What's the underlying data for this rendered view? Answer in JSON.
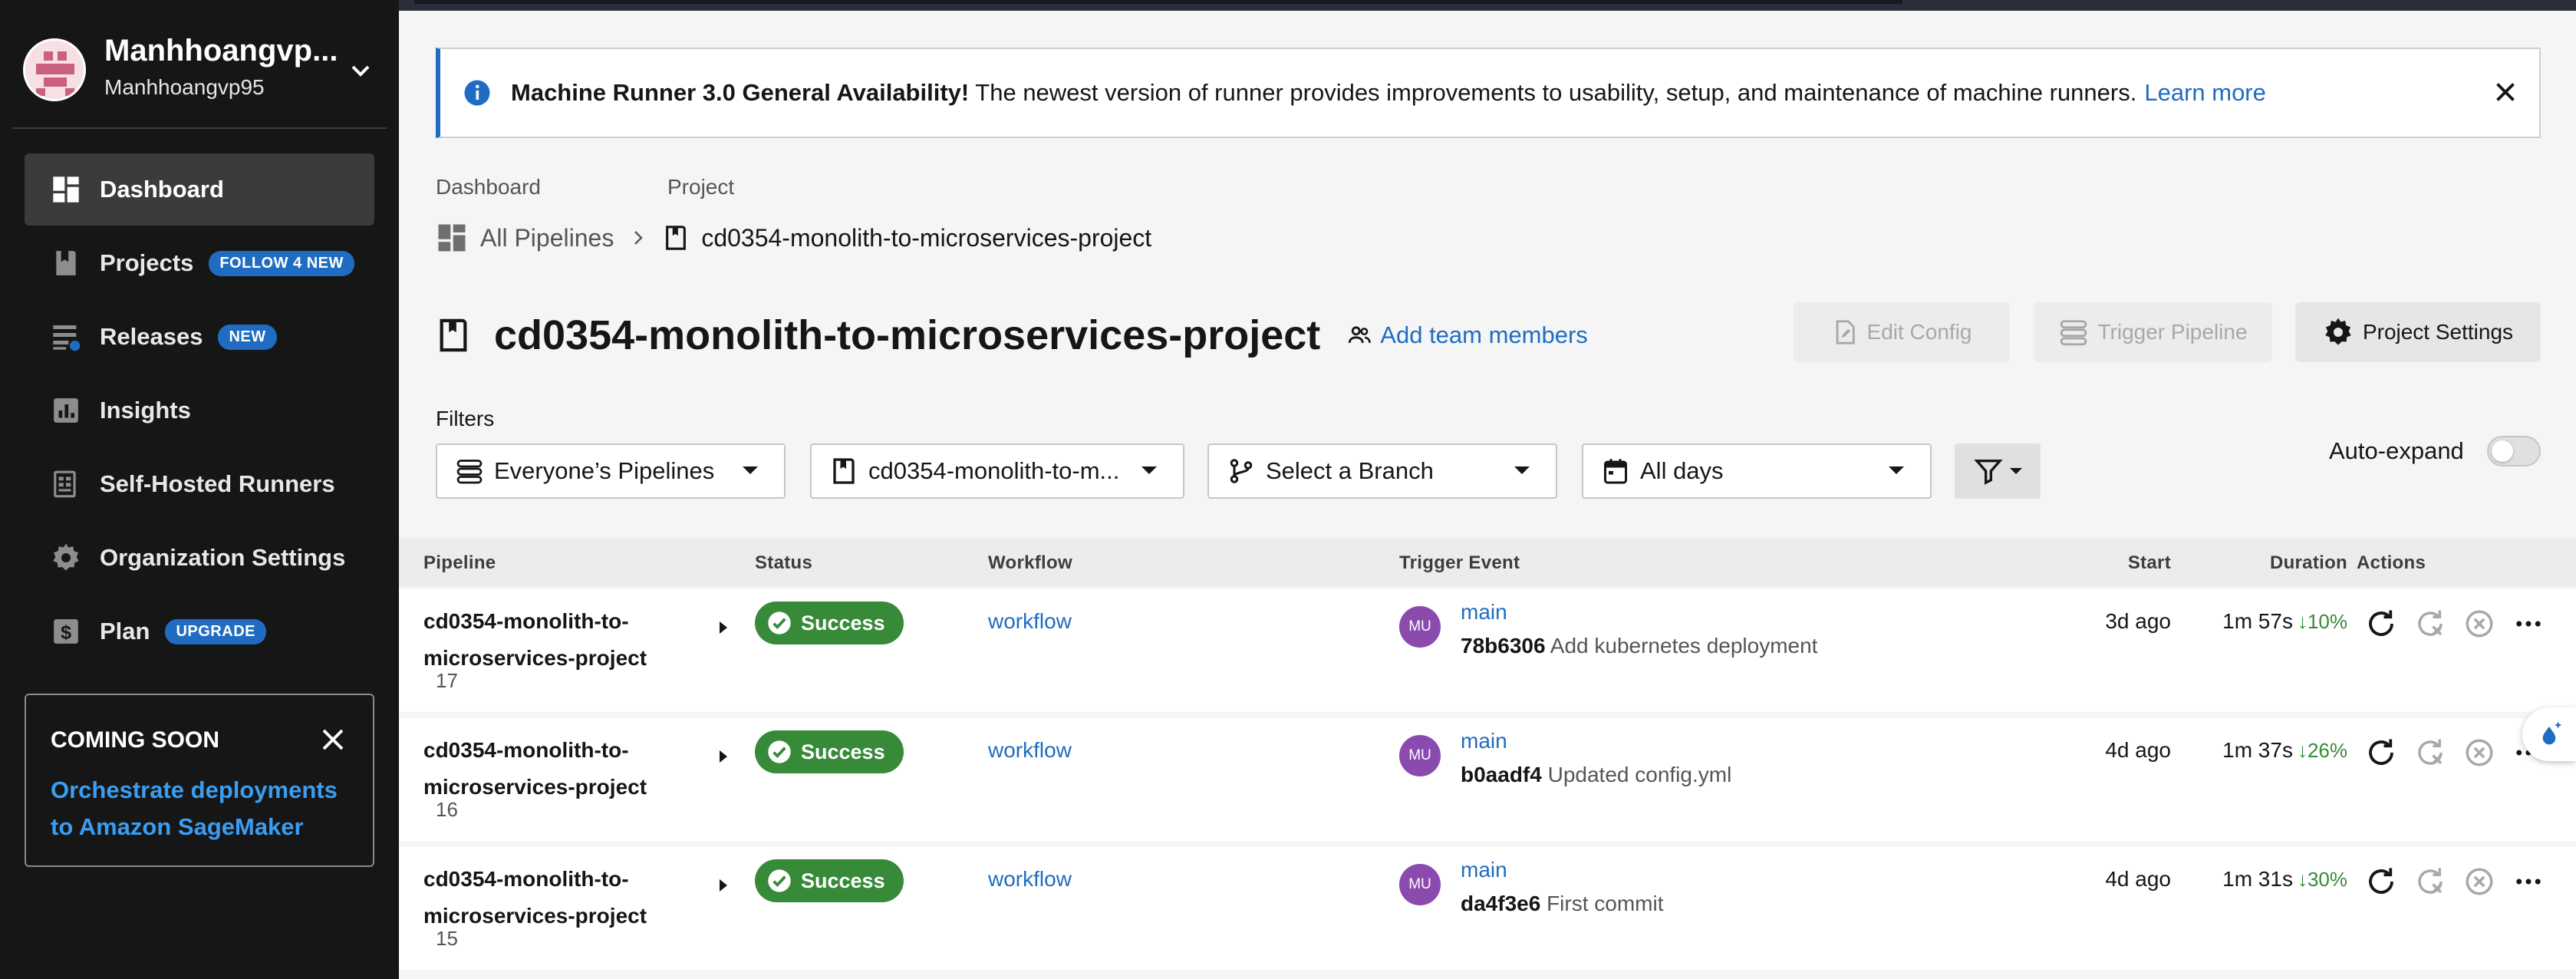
{
  "sidebar": {
    "org_name": "Manhhoangvp...",
    "org_user": "Manhhoangvp95",
    "items": [
      {
        "label": "Dashboard",
        "badge": ""
      },
      {
        "label": "Projects",
        "badge": "FOLLOW 4 NEW"
      },
      {
        "label": "Releases",
        "badge": "NEW"
      },
      {
        "label": "Insights",
        "badge": ""
      },
      {
        "label": "Self-Hosted Runners",
        "badge": ""
      },
      {
        "label": "Organization Settings",
        "badge": ""
      },
      {
        "label": "Plan",
        "badge": "UPGRADE"
      }
    ],
    "coming_soon": {
      "title": "COMING SOON",
      "link": "Orchestrate deployments to Amazon SageMaker"
    }
  },
  "banner": {
    "bold": "Machine Runner 3.0 General Availability!",
    "text": " The newest version of runner provides improvements to usability, setup, and maintenance of machine runners.",
    "link": "Learn more"
  },
  "breadcrumb": {
    "head_dashboard": "Dashboard",
    "head_project": "Project",
    "all_pipelines": "All Pipelines",
    "project": "cd0354-monolith-to-microservices-project"
  },
  "header": {
    "title": "cd0354-monolith-to-microservices-project",
    "add_team": "Add team members",
    "edit_config": "Edit Config",
    "trigger_pipeline": "Trigger Pipeline",
    "project_settings": "Project Settings"
  },
  "filters": {
    "label": "Filters",
    "pipelines": "Everyone’s Pipelines",
    "project": "cd0354-monolith-to-m...",
    "branch": "Select a Branch",
    "days": "All days",
    "auto_expand": "Auto-expand"
  },
  "table": {
    "headers": {
      "pipeline": "Pipeline",
      "status": "Status",
      "workflow": "Workflow",
      "trigger": "Trigger Event",
      "start": "Start",
      "duration": "Duration",
      "actions": "Actions"
    },
    "rows": [
      {
        "pipeline": "cd0354-monolith-to-microservices-project",
        "number": "17",
        "status": "Success",
        "workflow": "workflow",
        "avatar": "MU",
        "branch": "main",
        "sha": "78b6306",
        "message": " Add kubernetes deployment",
        "start": "3d ago",
        "duration": "1m 57s",
        "pct": "10%"
      },
      {
        "pipeline": "cd0354-monolith-to-microservices-project",
        "number": "16",
        "status": "Success",
        "workflow": "workflow",
        "avatar": "MU",
        "branch": "main",
        "sha": "b0aadf4",
        "message": " Updated config.yml",
        "start": "4d ago",
        "duration": "1m 37s",
        "pct": "26%"
      },
      {
        "pipeline": "cd0354-monolith-to-microservices-project",
        "number": "15",
        "status": "Success",
        "workflow": "workflow",
        "avatar": "MU",
        "branch": "main",
        "sha": "da4f3e6",
        "message": " First commit",
        "start": "4d ago",
        "duration": "1m 31s",
        "pct": "30%"
      }
    ]
  },
  "colors": {
    "accent": "#1f6cc2",
    "success": "#378a38",
    "sidebar_bg": "#161616",
    "avatar_bg": "#8b4aad"
  }
}
